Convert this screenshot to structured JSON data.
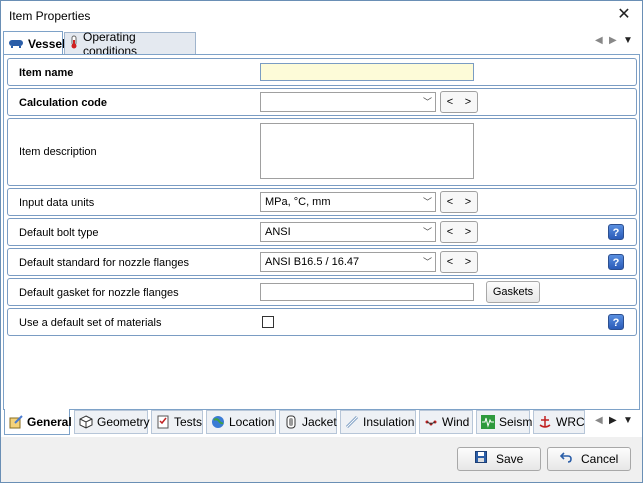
{
  "window": {
    "title": "Item Properties",
    "close_label": "✕"
  },
  "top_tabs": [
    {
      "label": "Vessel",
      "icon": "vessel-icon"
    },
    {
      "label": "Operating conditions",
      "icon": "thermometer-icon"
    }
  ],
  "form": {
    "item_name": {
      "label": "Item name",
      "value": ""
    },
    "calculation_code": {
      "label": "Calculation code",
      "value": ""
    },
    "item_description": {
      "label": "Item description",
      "value": ""
    },
    "input_data_units": {
      "label": "Input data units",
      "value": "MPa, °C, mm"
    },
    "default_bolt_type": {
      "label": "Default bolt type",
      "value": "ANSI"
    },
    "default_standard_flanges": {
      "label": "Default standard for nozzle flanges",
      "value": "ANSI B16.5 / 16.47"
    },
    "default_gasket": {
      "label": "Default gasket for nozzle flanges",
      "value": "",
      "button": "Gaskets"
    },
    "default_materials": {
      "label": "Use a default set of materials",
      "checked": false
    }
  },
  "nav": {
    "prev": "<",
    "next": ">"
  },
  "help": "?",
  "bottom_tabs": [
    {
      "label": "General",
      "icon": "general-icon"
    },
    {
      "label": "Geometry",
      "icon": "geometry-icon"
    },
    {
      "label": "Tests",
      "icon": "tests-icon"
    },
    {
      "label": "Location",
      "icon": "globe-icon"
    },
    {
      "label": "Jacket",
      "icon": "jacket-icon"
    },
    {
      "label": "Insulation",
      "icon": "insulation-icon"
    },
    {
      "label": "Wind",
      "icon": "wind-icon"
    },
    {
      "label": "Seism",
      "icon": "seism-icon"
    },
    {
      "label": "WRC",
      "icon": "wrc-icon"
    }
  ],
  "footer": {
    "save_label": "Save",
    "cancel_label": "Cancel"
  },
  "colors": {
    "accent": "#7a9cc3",
    "help": "#2a5bb8",
    "highlight": "#fdfbd8"
  }
}
